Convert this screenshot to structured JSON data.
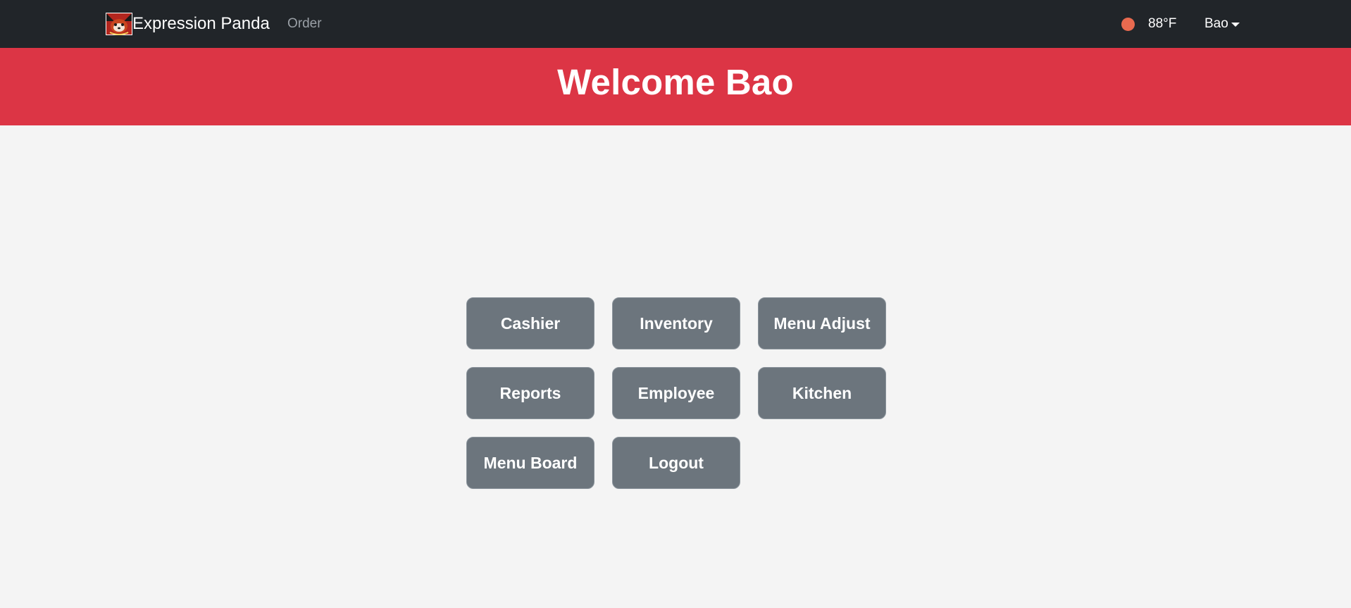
{
  "navbar": {
    "brand_name": "Expression Panda",
    "logo_icon": "red-panda-logo-icon",
    "links": [
      "Order"
    ],
    "weather": {
      "icon": "weather-dot-icon",
      "color": "#e96a4f",
      "temperature": "88°F"
    },
    "user": "Bao"
  },
  "banner": {
    "title": "Welcome Bao",
    "color": "#dc3545"
  },
  "menu": {
    "buttons": [
      "Cashier",
      "Inventory",
      "Menu Adjust",
      "Reports",
      "Employee",
      "Kitchen",
      "Menu Board",
      "Logout"
    ],
    "button_color": "#6c757d"
  }
}
